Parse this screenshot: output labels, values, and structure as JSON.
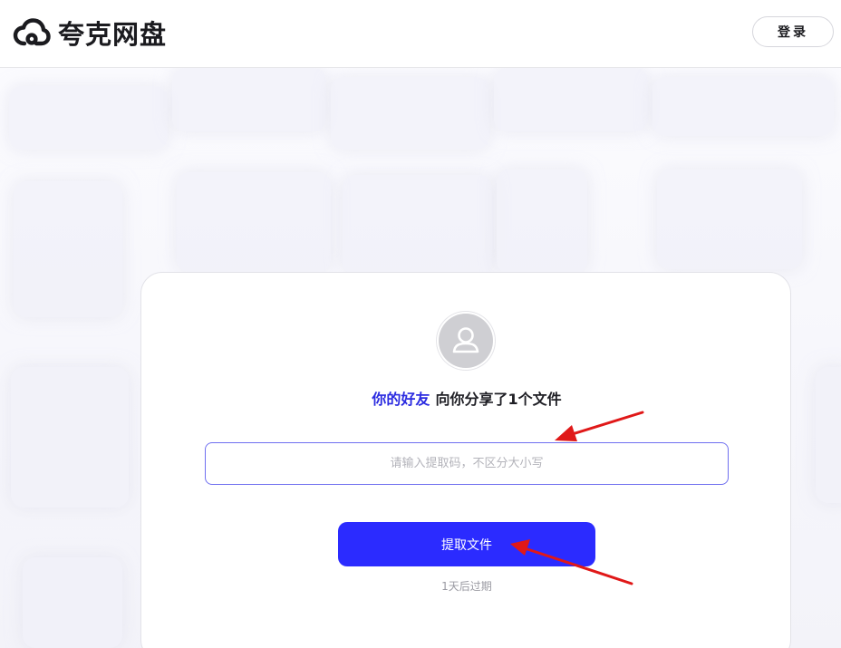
{
  "header": {
    "brand_name": "夸克网盘",
    "login_label": "登录"
  },
  "share": {
    "friend_label": "你的好友",
    "message": "向你分享了1个文件"
  },
  "code_input": {
    "value": "",
    "placeholder": "请输入提取码，不区分大小写"
  },
  "extract_label": "提取文件",
  "expire_text": "1天后过期",
  "colors": {
    "accent": "#2b2bff",
    "friend_text": "#2a2ae0",
    "annotation_arrow": "#e01818"
  },
  "icons": {
    "logo": "cloud-icon",
    "avatar": "user-icon",
    "annotations": "red-arrow-icon"
  }
}
